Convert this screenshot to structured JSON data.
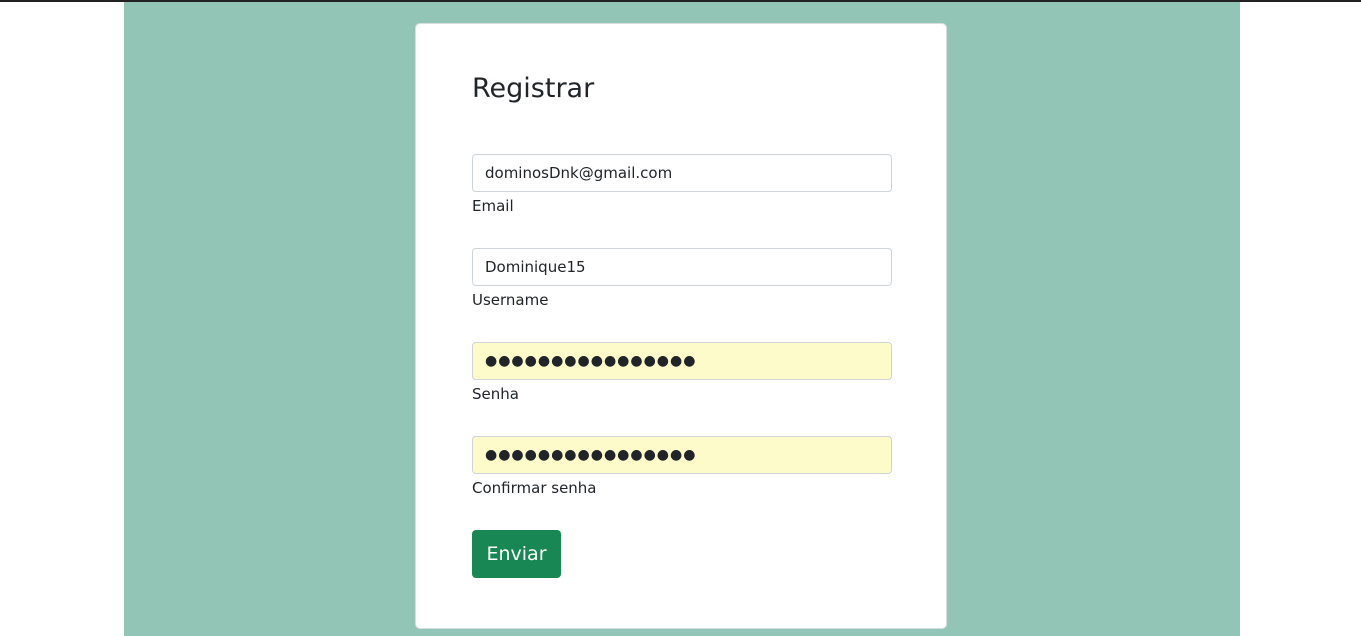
{
  "form": {
    "title": "Registrar",
    "email": {
      "value": "dominosDnk@gmail.com",
      "label": "Email"
    },
    "username": {
      "value": "Dominique15",
      "label": "Username"
    },
    "password": {
      "value": "●●●●●●●●●●●●●●●●",
      "label": "Senha"
    },
    "confirm_password": {
      "value": "●●●●●●●●●●●●●●●●",
      "label": "Confirmar senha"
    },
    "submit_label": "Enviar"
  },
  "colors": {
    "background_panel": "#93c5b7",
    "button": "#198754",
    "autofill": "#fefbcb"
  }
}
